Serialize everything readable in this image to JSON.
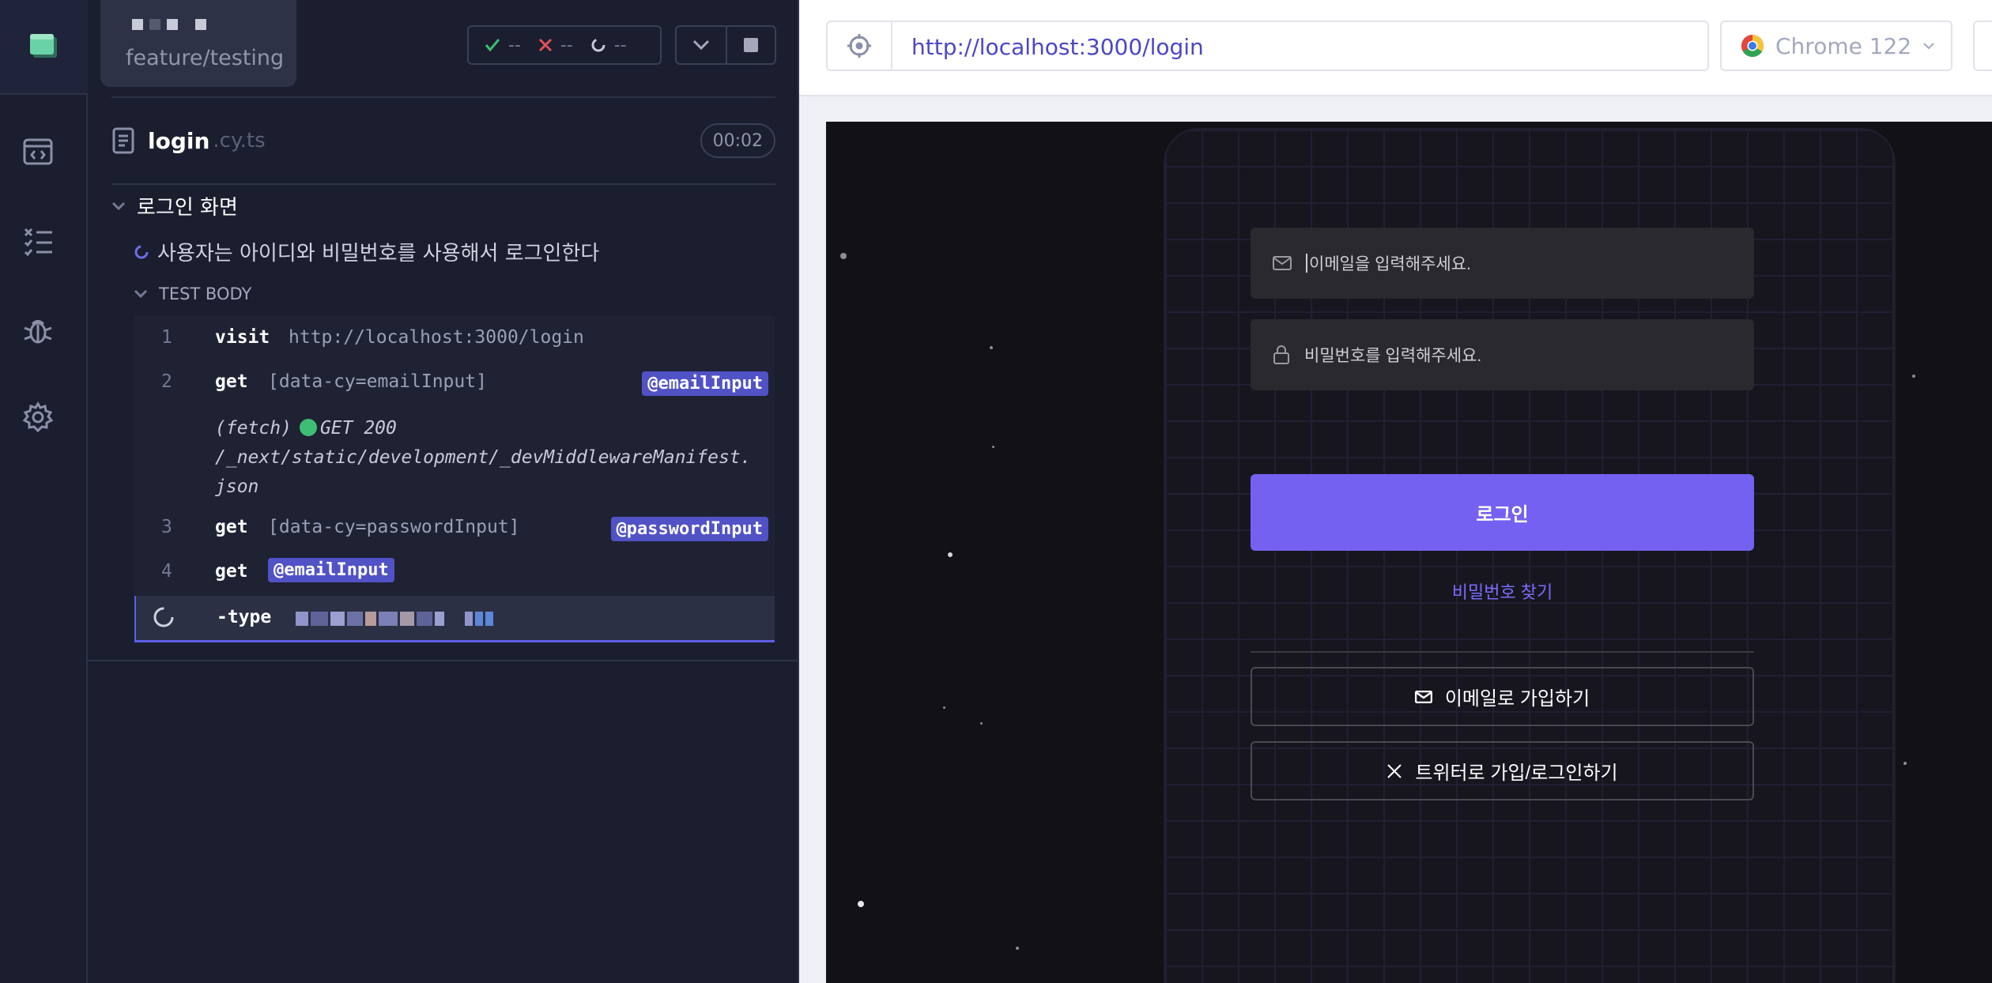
{
  "runner": {
    "branch": "feature/testing",
    "stats": {
      "passed": "--",
      "failed": "--",
      "pending": "--"
    },
    "spec": {
      "name": "login",
      "ext": ".cy.ts",
      "duration": "00:02"
    },
    "suite_title": "로그인 화면",
    "test_title": "사용자는 아이디와 비밀번호를 사용해서 로그인한다",
    "body_label": "TEST BODY",
    "commands": [
      {
        "num": "1",
        "name": "visit",
        "arg": "http://localhost:3000/login",
        "alias": ""
      },
      {
        "num": "2",
        "name": "get",
        "arg": "[data-cy=emailInput]",
        "alias": "@emailInput"
      },
      {
        "num": "",
        "name": "(fetch)",
        "arg": "GET 200 /_next/static/development/_devMiddlewareManifest.json",
        "alias": ""
      },
      {
        "num": "3",
        "name": "get",
        "arg": "[data-cy=passwordInput]",
        "alias": "@passwordInput"
      },
      {
        "num": "4",
        "name": "get",
        "arg": "",
        "alias": "@emailInput"
      },
      {
        "num": "",
        "name": "-type",
        "arg": "",
        "alias": ""
      }
    ],
    "fetch_line1": "GET 200",
    "fetch_line2": "/_next/static/development/_devMiddlewareManifest.",
    "fetch_line3": "json"
  },
  "browser": {
    "url": "http://localhost:3000/login",
    "name": "Chrome 122"
  },
  "app": {
    "email_placeholder": "이메일을 입력해주세요.",
    "password_placeholder": "비밀번호를 입력해주세요.",
    "login_label": "로그인",
    "forgot_label": "비밀번호 찾기",
    "signup_email_label": "이메일로 가입하기",
    "signup_twitter_label": "트위터로 가입/로그인하기"
  },
  "colors": {
    "accent": "#7461f2",
    "alias_badge": "#5152c6",
    "pass": "#3ebd74",
    "fail": "#e0505c"
  },
  "icons": [
    "runner-logo-icon",
    "specs-icon",
    "runs-icon",
    "debug-icon",
    "settings-icon",
    "spec-file-icon",
    "crosshair-icon",
    "chrome-icon",
    "mail-icon",
    "lock-icon",
    "x-logo-icon"
  ]
}
